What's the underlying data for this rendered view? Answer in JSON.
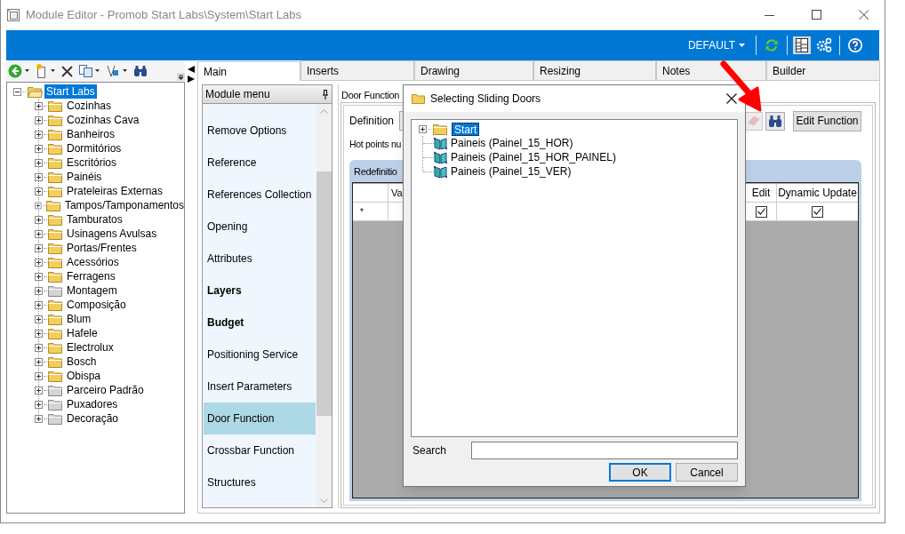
{
  "window": {
    "title": "Module Editor - Promob Start Labs\\System\\Start Labs"
  },
  "top_bar": {
    "profile": "DEFAULT"
  },
  "tree": {
    "label": "Start Labs",
    "selected": true,
    "children": [
      {
        "label": "Cozinhas",
        "color": "#f2cf5b"
      },
      {
        "label": "Cozinhas Cava",
        "color": "#f2cf5b"
      },
      {
        "label": "Banheiros",
        "color": "#f2cf5b"
      },
      {
        "label": "Dormitórios",
        "color": "#f2cf5b"
      },
      {
        "label": "Escritórios",
        "color": "#f2cf5b"
      },
      {
        "label": "Painéis",
        "color": "#f2cf5b"
      },
      {
        "label": "Prateleiras Externas",
        "color": "#f2cf5b"
      },
      {
        "label": "Tampos/Tamponamentos",
        "color": "#f2cf5b"
      },
      {
        "label": "Tamburatos",
        "color": "#f2cf5b"
      },
      {
        "label": "Usinagens Avulsas",
        "color": "#f2cf5b"
      },
      {
        "label": "Portas/Frentes",
        "color": "#f2cf5b"
      },
      {
        "label": "Acessórios",
        "color": "#f2cf5b"
      },
      {
        "label": "Ferragens",
        "color": "#f2cf5b"
      },
      {
        "label": "Montagem",
        "color": "#d4d4d4"
      },
      {
        "label": "Composição",
        "color": "#f2cf5b"
      },
      {
        "label": "Blum",
        "color": "#f2cf5b"
      },
      {
        "label": "Hafele",
        "color": "#f2cf5b"
      },
      {
        "label": "Electrolux",
        "color": "#f2cf5b"
      },
      {
        "label": "Bosch",
        "color": "#f2cf5b"
      },
      {
        "label": "Obispa",
        "color": "#f2cf5b"
      },
      {
        "label": "Parceiro Padrão",
        "color": "#d4d4d4"
      },
      {
        "label": "Puxadores",
        "color": "#d4d4d4"
      },
      {
        "label": "Decoração",
        "color": "#d4d4d4"
      }
    ]
  },
  "tabs": [
    {
      "label": "Main",
      "selected": true
    },
    {
      "label": "Inserts",
      "selected": false
    },
    {
      "label": "Drawing",
      "selected": false
    },
    {
      "label": "Resizing",
      "selected": false
    },
    {
      "label": "Notes",
      "selected": false
    },
    {
      "label": "Builder",
      "selected": false
    }
  ],
  "module_menu": {
    "title": "Module menu",
    "items": [
      {
        "label": "Remove Options",
        "bold": false,
        "selected": false
      },
      {
        "label": "Reference",
        "bold": false,
        "selected": false
      },
      {
        "label": "References Collection",
        "bold": false,
        "selected": false
      },
      {
        "label": "Opening",
        "bold": false,
        "selected": false
      },
      {
        "label": "Attributes",
        "bold": false,
        "selected": false
      },
      {
        "label": "Layers",
        "bold": true,
        "selected": false
      },
      {
        "label": "Budget",
        "bold": true,
        "selected": false
      },
      {
        "label": "Positioning Service",
        "bold": false,
        "selected": false
      },
      {
        "label": "Insert Parameters",
        "bold": false,
        "selected": false
      },
      {
        "label": "Door Function",
        "bold": false,
        "selected": true
      },
      {
        "label": "Crossbar Function",
        "bold": false,
        "selected": false
      },
      {
        "label": "Structures",
        "bold": false,
        "selected": false
      }
    ]
  },
  "door_function": {
    "title": "Door Function",
    "definition_label": "Definition",
    "hot_points": "Hot points nu",
    "edit_button": "Edit Function",
    "redefinition": {
      "title": "Redefinitio",
      "columns": [
        "Va",
        "Edit",
        "Dynamic Update"
      ],
      "rows": [
        {
          "marker": "*",
          "edit": true,
          "dynamic_update": true
        }
      ]
    }
  },
  "dialog": {
    "title": "Selecting Sliding Doors",
    "tree": {
      "label": "Start",
      "selected": true,
      "children": [
        {
          "label": "Paineis (Painel_15_HOR)"
        },
        {
          "label": "Paineis (Painel_15_HOR_PAINEL)"
        },
        {
          "label": "Paineis (Painel_15_VER)"
        }
      ]
    },
    "search_label": "Search",
    "buttons": [
      {
        "label": "OK",
        "default": true
      },
      {
        "label": "Cancel",
        "default": false
      }
    ]
  }
}
